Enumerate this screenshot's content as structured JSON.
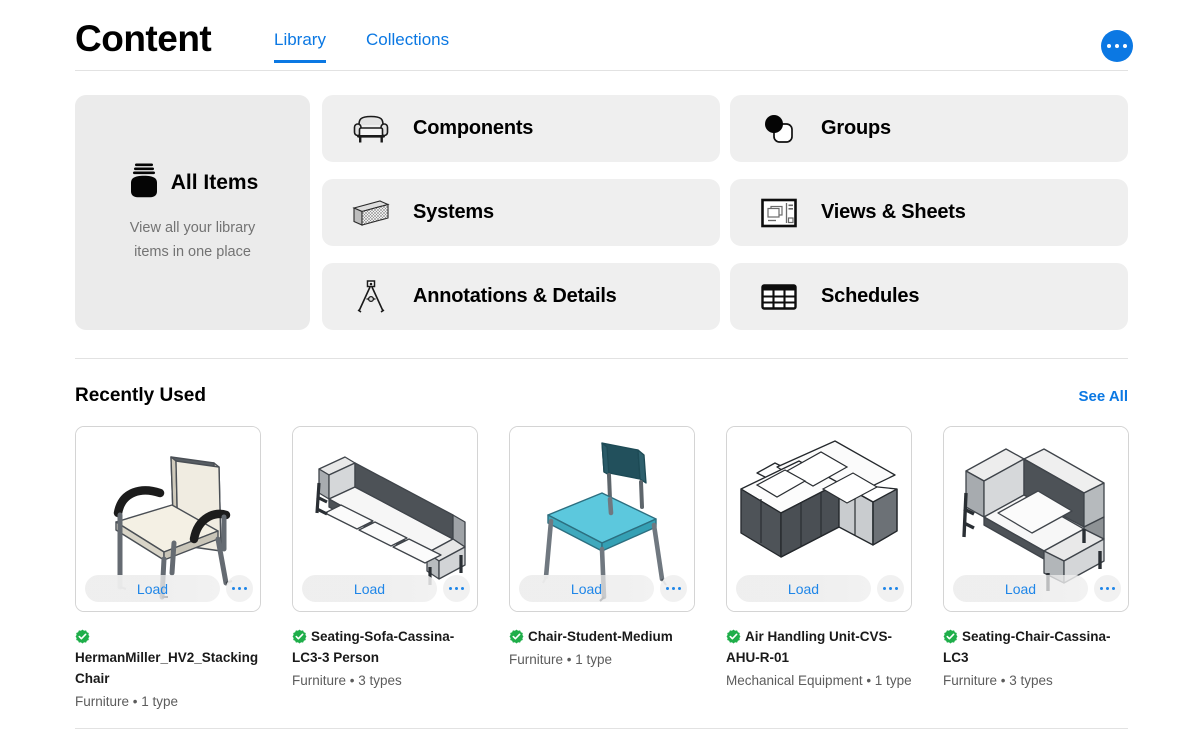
{
  "header": {
    "title": "Content",
    "tabs": [
      {
        "label": "Library",
        "active": true
      },
      {
        "label": "Collections",
        "active": false
      }
    ],
    "more_button": "more-options"
  },
  "categories": {
    "all_items": {
      "label": "All Items",
      "description": "View all your library items in one place",
      "icon": "jar-icon"
    },
    "middle_column": [
      {
        "label": "Components",
        "icon": "armchair-icon"
      },
      {
        "label": "Systems",
        "icon": "wall-assembly-icon"
      },
      {
        "label": "Annotations & Details",
        "icon": "compass-icon"
      }
    ],
    "right_column": [
      {
        "label": "Groups",
        "icon": "overlapping-shapes-icon"
      },
      {
        "label": "Views & Sheets",
        "icon": "views-sheets-icon"
      },
      {
        "label": "Schedules",
        "icon": "table-grid-icon"
      }
    ]
  },
  "recently_used": {
    "title": "Recently Used",
    "see_all_label": "See All",
    "load_label": "Load",
    "more_label": "more-options",
    "verified_badge": "verified-check-icon",
    "items": [
      {
        "name": "HermanMiller_HV2_StackingChair",
        "category": "Furniture",
        "types": "1 type",
        "meta": "Furniture • 1 type",
        "thumbnail": "stacking-chair-3d",
        "verified": true
      },
      {
        "name": "Seating-Sofa-Cassina-LC3-3 Person",
        "category": "Furniture",
        "types": "3 types",
        "meta": "Furniture • 3 types",
        "thumbnail": "sofa-3d",
        "verified": true
      },
      {
        "name": "Chair-Student-Medium",
        "category": "Furniture",
        "types": "1 type",
        "meta": "Furniture • 1 type",
        "thumbnail": "student-chair-3d",
        "verified": true
      },
      {
        "name": "Air Handling Unit-CVS-AHU-R-01",
        "category": "Mechanical Equipment",
        "types": "1 type",
        "meta": "Mechanical Equipment • 1 type",
        "thumbnail": "air-handling-unit-3d",
        "verified": true
      },
      {
        "name": "Seating-Chair-Cassina-LC3",
        "category": "Furniture",
        "types": "3 types",
        "meta": "Furniture • 3 types",
        "thumbnail": "armchair-3d",
        "verified": true
      }
    ]
  },
  "colors": {
    "accent": "#0b78e3",
    "card_bg": "#efefef",
    "all_items_bg": "#ebebeb",
    "verified_green": "#1fae4a",
    "divider": "#e2e2e2",
    "muted_text": "#5c5c5c"
  }
}
